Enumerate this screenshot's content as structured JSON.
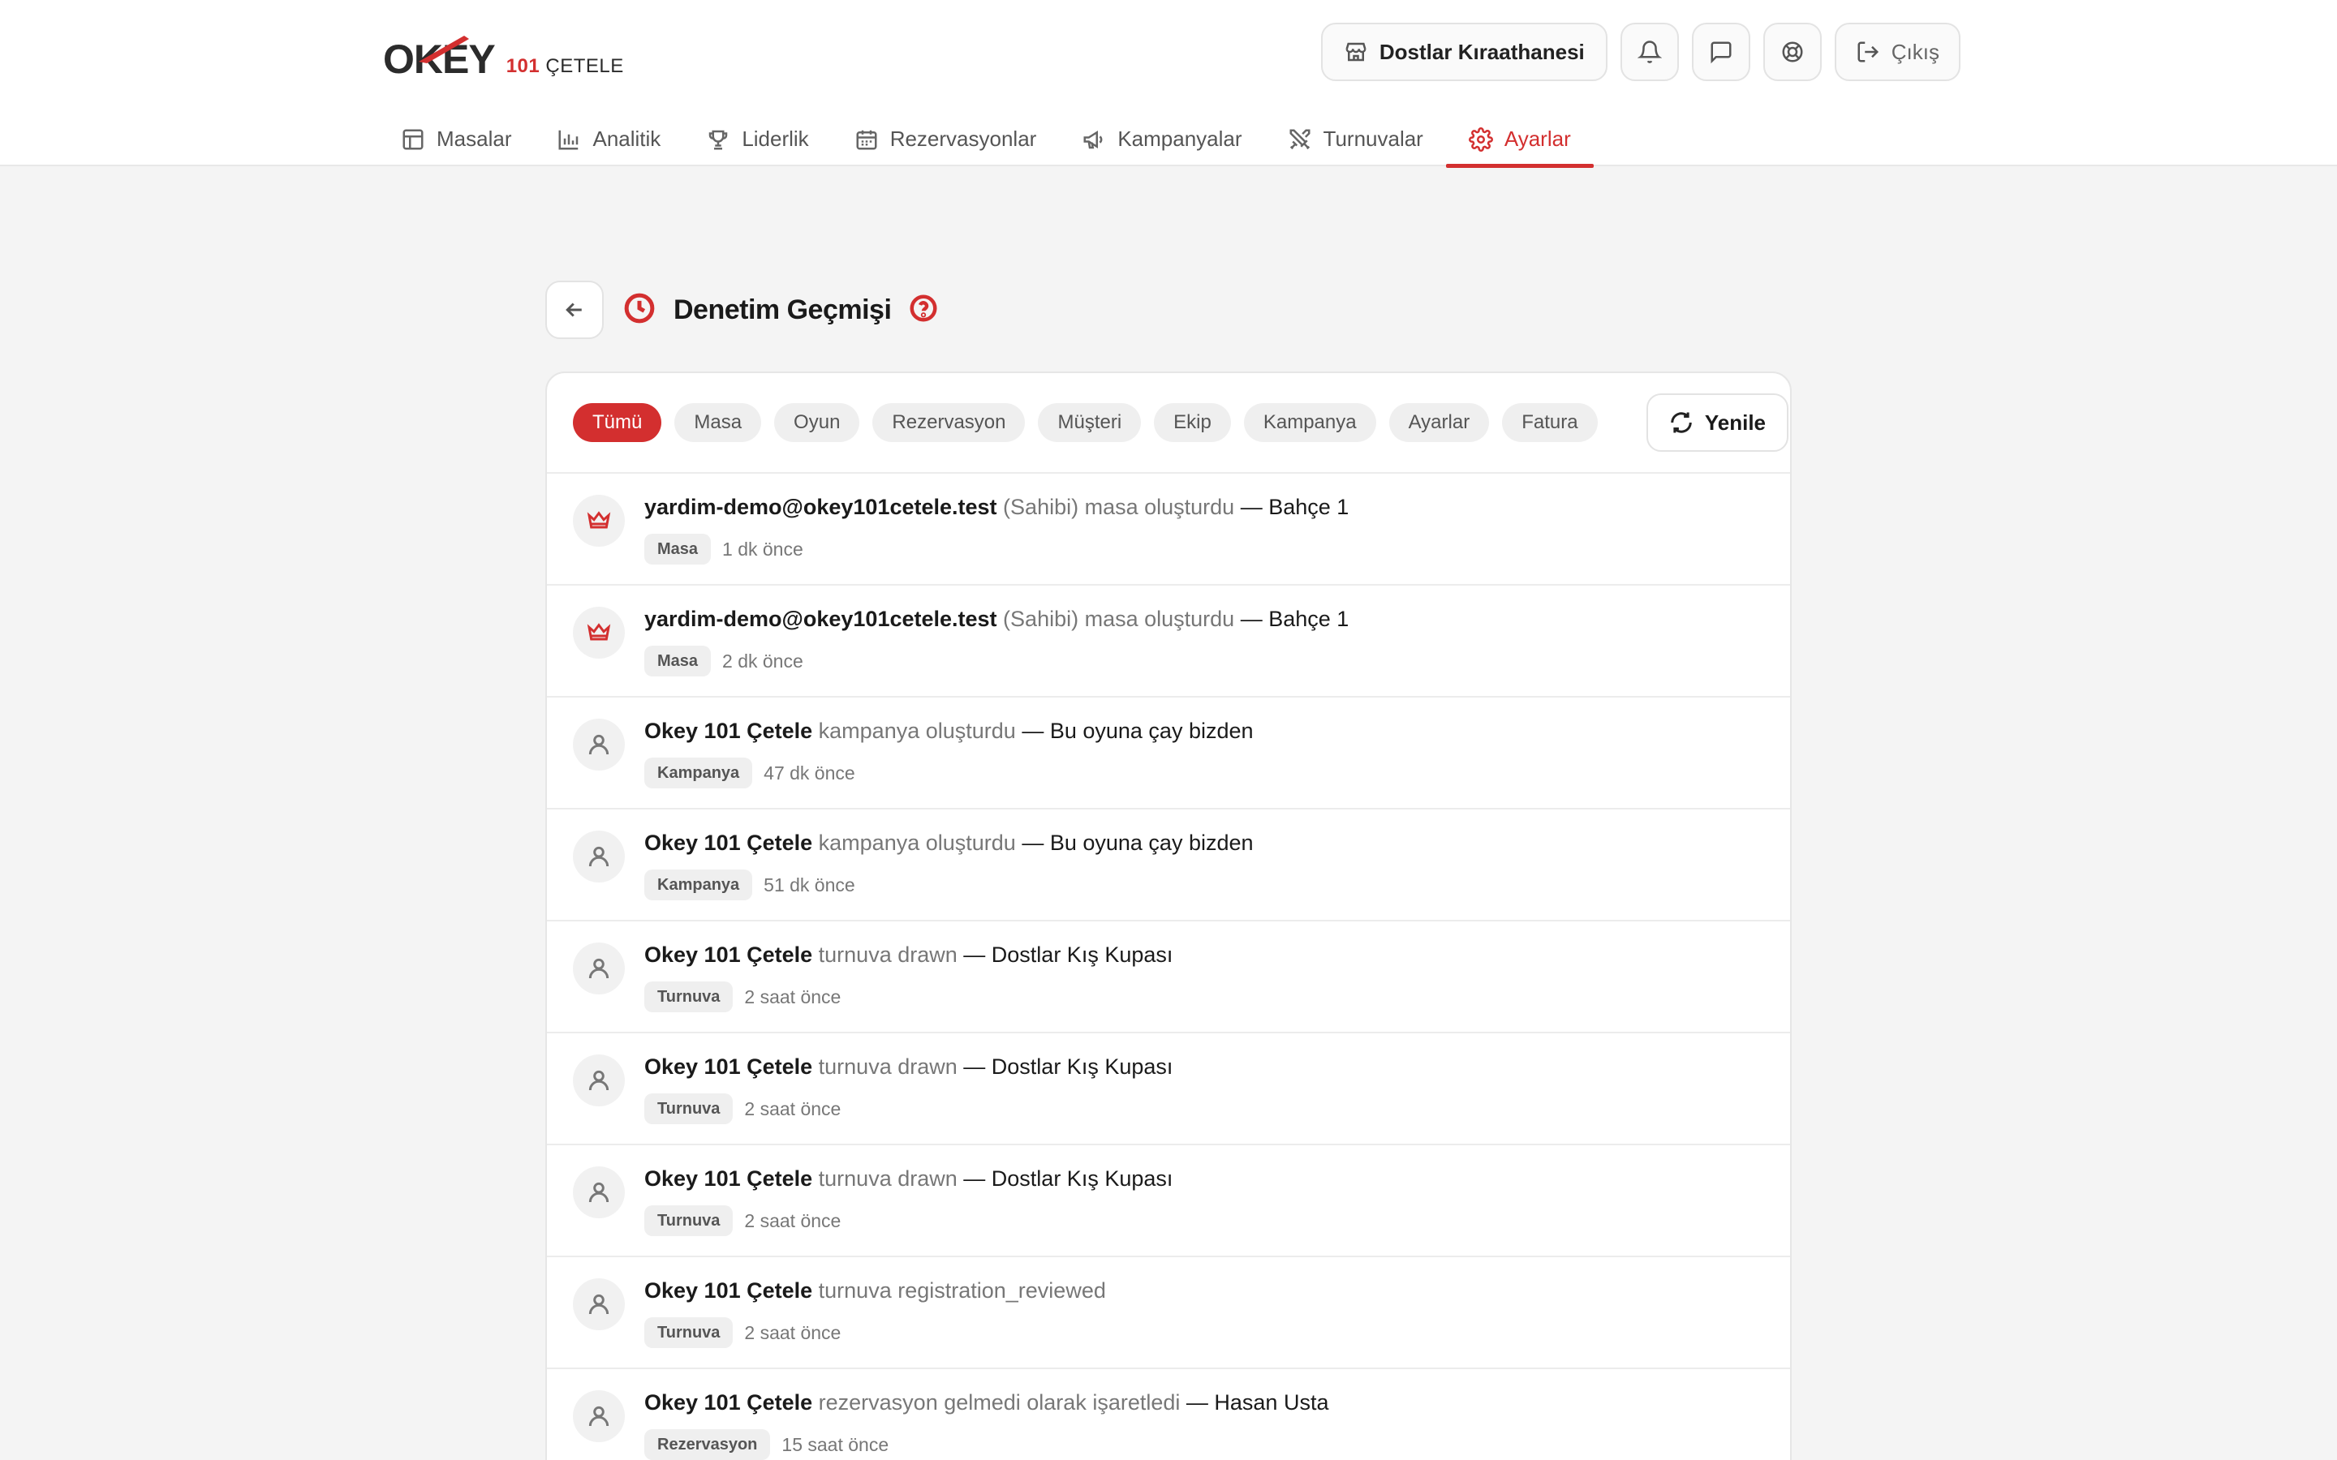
{
  "logo": {
    "word": "OKEY",
    "num": "101",
    "sub": "ÇETELE"
  },
  "header": {
    "venue_label": "Dostlar Kıraathanesi",
    "logout_label": "Çıkış",
    "icons": [
      "store-icon",
      "bell-icon",
      "message-icon",
      "support-icon",
      "logout-icon"
    ]
  },
  "nav": {
    "items": [
      {
        "label": "Masalar",
        "icon": "table-icon"
      },
      {
        "label": "Analitik",
        "icon": "bar-chart-icon"
      },
      {
        "label": "Liderlik",
        "icon": "trophy-icon"
      },
      {
        "label": "Rezervasyonlar",
        "icon": "calendar-icon"
      },
      {
        "label": "Kampanyalar",
        "icon": "megaphone-icon"
      },
      {
        "label": "Turnuvalar",
        "icon": "swords-icon"
      },
      {
        "label": "Ayarlar",
        "icon": "gear-icon",
        "active": true
      }
    ]
  },
  "page": {
    "title": "Denetim Geçmişi"
  },
  "filters": {
    "chips": [
      "Tümü",
      "Masa",
      "Oyun",
      "Rezervasyon",
      "Müşteri",
      "Ekip",
      "Kampanya",
      "Ayarlar",
      "Fatura"
    ],
    "active": "Tümü",
    "refresh_label": "Yenile"
  },
  "logs": [
    {
      "actor": "yardim-demo@okey101cetele.test",
      "action": "(Sahibi) masa oluşturdu",
      "target": "— Bahçe 1",
      "tag": "Masa",
      "time": "1 dk önce",
      "avatar": "crown-icon"
    },
    {
      "actor": "yardim-demo@okey101cetele.test",
      "action": "(Sahibi) masa oluşturdu",
      "target": "— Bahçe 1",
      "tag": "Masa",
      "time": "2 dk önce",
      "avatar": "crown-icon"
    },
    {
      "actor": "Okey 101 Çetele",
      "action": "kampanya oluşturdu",
      "target": "— Bu oyuna çay bizden",
      "tag": "Kampanya",
      "time": "47 dk önce",
      "avatar": "user-icon"
    },
    {
      "actor": "Okey 101 Çetele",
      "action": "kampanya oluşturdu",
      "target": "— Bu oyuna çay bizden",
      "tag": "Kampanya",
      "time": "51 dk önce",
      "avatar": "user-icon"
    },
    {
      "actor": "Okey 101 Çetele",
      "action": "turnuva drawn",
      "target": "— Dostlar Kış Kupası",
      "tag": "Turnuva",
      "time": "2 saat önce",
      "avatar": "user-icon"
    },
    {
      "actor": "Okey 101 Çetele",
      "action": "turnuva drawn",
      "target": "— Dostlar Kış Kupası",
      "tag": "Turnuva",
      "time": "2 saat önce",
      "avatar": "user-icon"
    },
    {
      "actor": "Okey 101 Çetele",
      "action": "turnuva drawn",
      "target": "— Dostlar Kış Kupası",
      "tag": "Turnuva",
      "time": "2 saat önce",
      "avatar": "user-icon"
    },
    {
      "actor": "Okey 101 Çetele",
      "action": "turnuva registration_reviewed",
      "target": "",
      "tag": "Turnuva",
      "time": "2 saat önce",
      "avatar": "user-icon"
    },
    {
      "actor": "Okey 101 Çetele",
      "action": "rezervasyon gelmedi olarak işaretledi",
      "target": "— Hasan Usta",
      "tag": "Rezervasyon",
      "time": "15 saat önce",
      "avatar": "user-icon"
    }
  ],
  "colors": {
    "accent": "#d32f2f",
    "background": "#f4f4f4"
  }
}
